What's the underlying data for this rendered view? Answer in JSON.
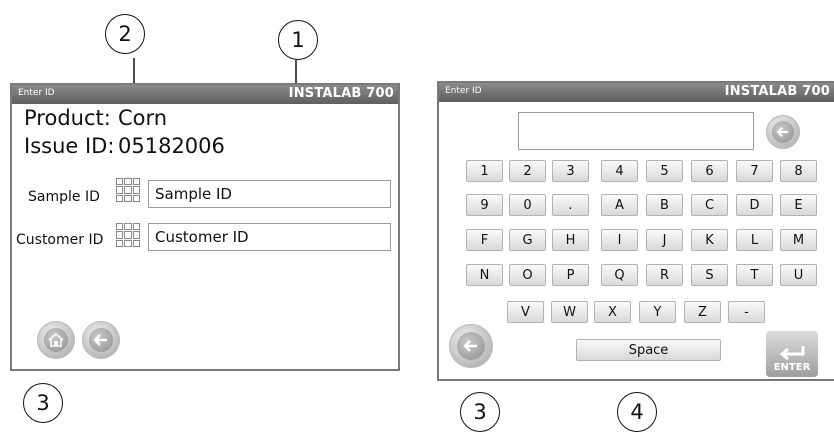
{
  "callouts": {
    "c1": "1",
    "c2": "2",
    "c3_left": "3",
    "c3_right": "3",
    "c4": "4"
  },
  "left_window": {
    "title_left": "Enter ID",
    "title_right": "INSTALAB 700",
    "product_label": "Product:",
    "product_value": "Corn",
    "issue_label": "Issue ID:",
    "issue_value": "05182006",
    "sample_label": "Sample ID",
    "sample_value": "Sample ID",
    "customer_label": "Customer ID",
    "customer_value": "Customer ID",
    "home_icon": "home-icon",
    "back_icon": "back-arrow-icon"
  },
  "right_window": {
    "title_left": "Enter ID",
    "title_right": "INSTALAB 700",
    "input_value": "",
    "keys_row1": [
      "1",
      "2",
      "3",
      "4",
      "5",
      "6",
      "7",
      "8"
    ],
    "keys_row2": [
      "9",
      "0",
      ".",
      "A",
      "B",
      "C",
      "D",
      "E"
    ],
    "keys_row3": [
      "F",
      "G",
      "H",
      "I",
      "J",
      "K",
      "L",
      "M"
    ],
    "keys_row4": [
      "N",
      "O",
      "P",
      "Q",
      "R",
      "S",
      "T",
      "U"
    ],
    "keys_row5": [
      "V",
      "W",
      "X",
      "Y",
      "Z",
      "-"
    ],
    "space_label": "Space",
    "enter_label": "ENTER"
  },
  "colors": {
    "titlebar": "#6e6e6e",
    "border": "#7a7a7a"
  }
}
